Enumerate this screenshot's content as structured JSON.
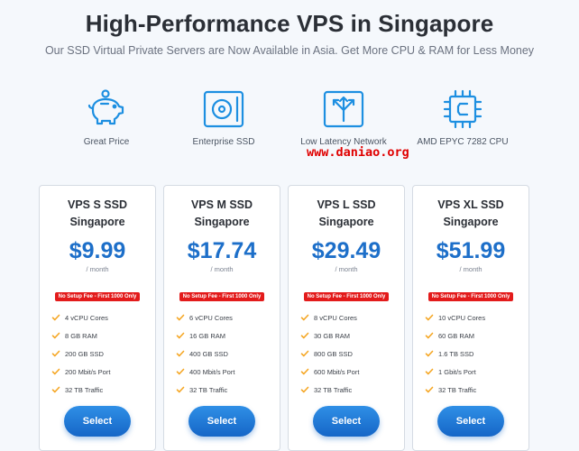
{
  "header": {
    "title": "High-Performance VPS in Singapore",
    "subtitle": "Our SSD Virtual Private Servers are Now Available in Asia. Get More CPU & RAM for Less Money"
  },
  "features": [
    {
      "icon": "piggy-bank-icon",
      "label": "Great Price"
    },
    {
      "icon": "ssd-drive-icon",
      "label": "Enterprise SSD"
    },
    {
      "icon": "network-arrows-icon",
      "label": "Low Latency Network"
    },
    {
      "icon": "cpu-chip-icon",
      "label": "AMD EPYC 7282 CPU"
    }
  ],
  "watermark": "www.daniao.org",
  "accent_color": "#1d6fc9",
  "badge_color": "#e31b1b",
  "check_color": "#f5a623",
  "plans": [
    {
      "name": "VPS S SSD",
      "region": "Singapore",
      "price": "$9.99",
      "period": "/ month",
      "badge": "No Setup Fee - First 1000 Only",
      "specs": [
        "4 vCPU Cores",
        "8 GB RAM",
        "200 GB SSD",
        "200 Mbit/s Port",
        "32 TB Traffic"
      ],
      "button": "Select"
    },
    {
      "name": "VPS M SSD",
      "region": "Singapore",
      "price": "$17.74",
      "period": "/ month",
      "badge": "No Setup Fee - First 1000 Only",
      "specs": [
        "6 vCPU Cores",
        "16 GB RAM",
        "400 GB SSD",
        "400 Mbit/s Port",
        "32 TB Traffic"
      ],
      "button": "Select"
    },
    {
      "name": "VPS L SSD",
      "region": "Singapore",
      "price": "$29.49",
      "period": "/ month",
      "badge": "No Setup Fee - First 1000 Only",
      "specs": [
        "8 vCPU Cores",
        "30 GB RAM",
        "800 GB SSD",
        "600 Mbit/s Port",
        "32 TB Traffic"
      ],
      "button": "Select"
    },
    {
      "name": "VPS XL SSD",
      "region": "Singapore",
      "price": "$51.99",
      "period": "/ month",
      "badge": "No Setup Fee - First 1000 Only",
      "specs": [
        "10 vCPU Cores",
        "60 GB RAM",
        "1.6 TB SSD",
        "1 Gbit/s Port",
        "32 TB Traffic"
      ],
      "button": "Select"
    }
  ]
}
